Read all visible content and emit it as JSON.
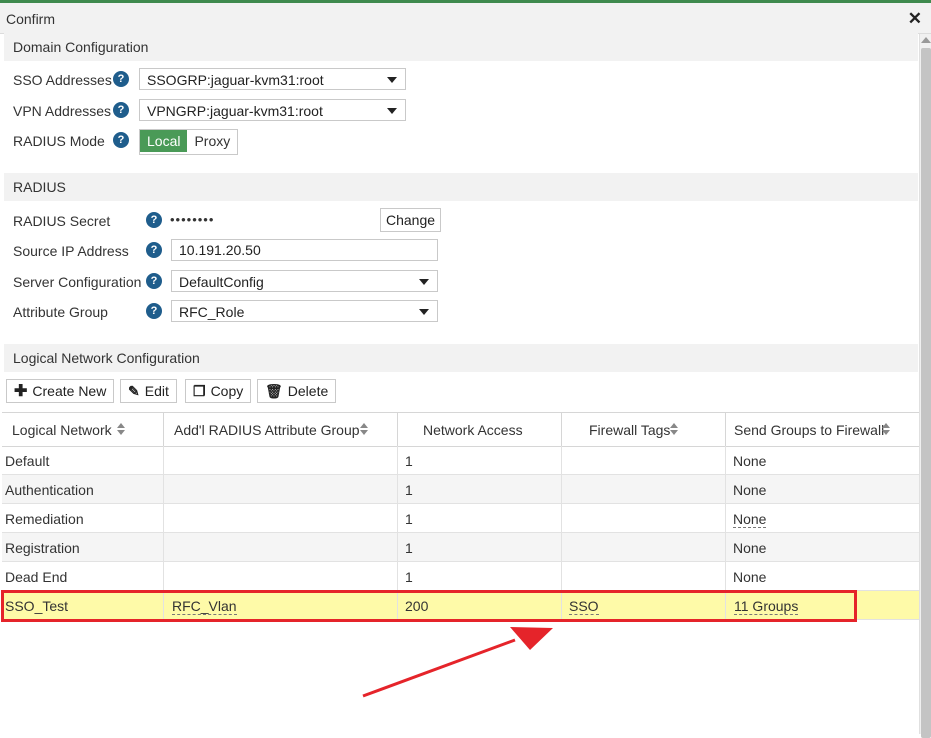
{
  "dialog": {
    "title": "Confirm",
    "close_glyph": "✕"
  },
  "sections": {
    "domain": "Domain Configuration",
    "radius": "RADIUS",
    "logical": "Logical Network Configuration"
  },
  "domain": {
    "sso_label": "SSO Addresses",
    "sso_value": "SSOGRP:jaguar-kvm31:root",
    "vpn_label": "VPN Addresses",
    "vpn_value": "VPNGRP:jaguar-kvm31:root",
    "mode_label": "RADIUS Mode",
    "mode_options": [
      "Local",
      "Proxy"
    ],
    "mode_selected": "Local"
  },
  "radius": {
    "secret_label": "RADIUS Secret",
    "secret_value": "••••••••",
    "change_label": "Change",
    "source_ip_label": "Source IP Address",
    "source_ip_value": "10.191.20.50",
    "server_config_label": "Server Configuration",
    "server_config_value": "DefaultConfig",
    "attr_group_label": "Attribute Group",
    "attr_group_value": "RFC_Role"
  },
  "help_glyph": "?",
  "toolbar": {
    "create_label": "Create New",
    "edit_label": "Edit",
    "copy_label": "Copy",
    "delete_label": "Delete"
  },
  "table": {
    "columns": [
      "Logical Network",
      "Add'l RADIUS Attribute Group",
      "Network Access",
      "Firewall Tags",
      "Send Groups to Firewall"
    ],
    "rows": [
      {
        "name": "Default",
        "attr_group": "",
        "access": "1",
        "tags": "",
        "send": "None"
      },
      {
        "name": "Authentication",
        "attr_group": "",
        "access": "1",
        "tags": "",
        "send": "None"
      },
      {
        "name": "Remediation",
        "attr_group": "",
        "access": "1",
        "tags": "",
        "send": "None"
      },
      {
        "name": "Registration",
        "attr_group": "",
        "access": "1",
        "tags": "",
        "send": "None"
      },
      {
        "name": "Dead End",
        "attr_group": "",
        "access": "1",
        "tags": "",
        "send": "None"
      },
      {
        "name": "SSO_Test",
        "attr_group": "RFC_Vlan",
        "access": "200",
        "tags": "SSO",
        "send": "11 Groups"
      }
    ]
  },
  "colors": {
    "accent_green": "#4a9a57",
    "help_blue": "#1f5d8c",
    "selected_row": "#fefaa8",
    "annotation_red": "#e5242a"
  }
}
